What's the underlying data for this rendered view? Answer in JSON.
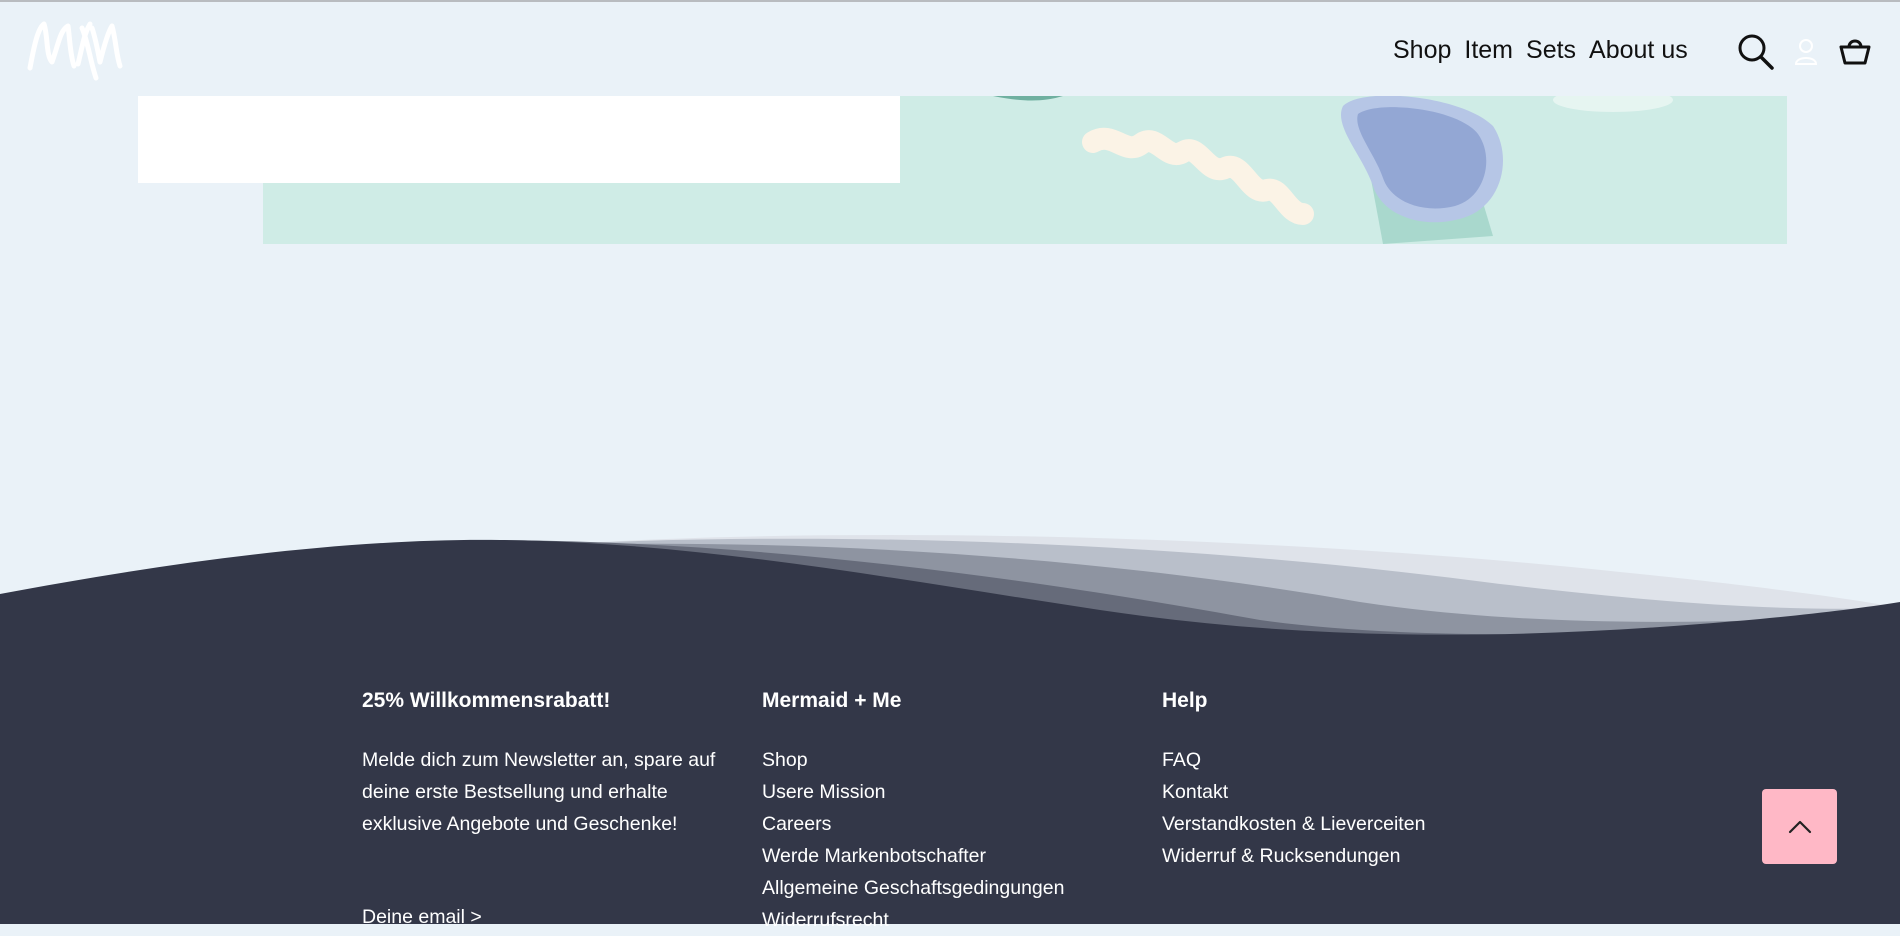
{
  "header": {
    "logo_text": "MxM",
    "nav": [
      "Shop",
      "Item",
      "Sets",
      "About us"
    ],
    "icons": [
      "search-icon",
      "user-icon",
      "cart-icon"
    ]
  },
  "footer": {
    "col1": {
      "title": "25% Willkommensrabatt!",
      "text": "Melde dich zum Newsletter an, spare auf deine erste Bestsellung und erhalte exklusive Angebote und Geschenke!",
      "newsletter_link": "Deine email >"
    },
    "col2": {
      "title": "Mermaid + Me",
      "links": [
        "Shop",
        "Usere Mission",
        "Careers",
        "Werde Markenbotschafter",
        "Allgemeine Geschaftsgedingungen",
        "Widerrufsrecht"
      ]
    },
    "col3": {
      "title": "Help",
      "links": [
        "FAQ",
        "Kontakt",
        "Verstandkosten & Lieverceiten",
        "Widerruf & Rucksendungen"
      ]
    }
  },
  "colors": {
    "page_bg": "#eaf2f8",
    "footer_bg": "#333748",
    "hero_bg": "#cfece6",
    "back_to_top": "#ffb8c6"
  }
}
